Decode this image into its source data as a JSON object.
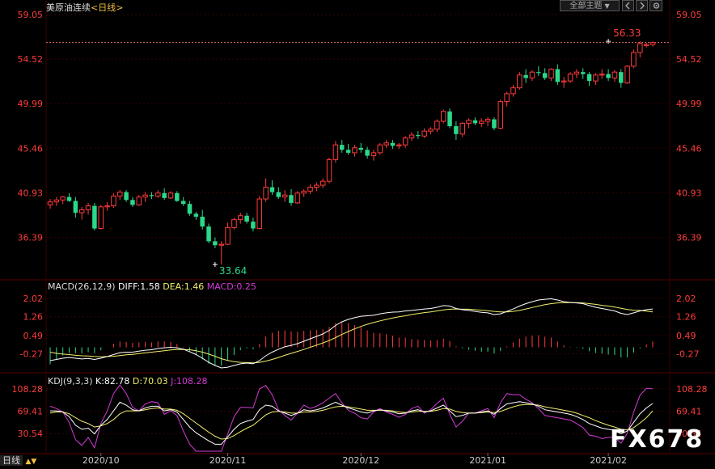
{
  "header": {
    "title": "美原油连续",
    "period_open": "<",
    "period": "日线",
    "period_close": ">"
  },
  "toolbar": {
    "dropdown_label": "全部主题",
    "dropdown_arrow": "▼",
    "prev_icon": "arrow-left-icon",
    "next_icon": "arrow-right-icon",
    "settings_icon": "gear-icon"
  },
  "watermark": "FX678",
  "bottom_bar": {
    "period": "日线",
    "arrows": "▲▼"
  },
  "colors": {
    "background": "#000000",
    "up": "#ff3b3b",
    "down": "#2bd88a",
    "grid": "#3a0000",
    "axis_text": "#ff3b3b",
    "diff": "#ffffff",
    "dea": "#f2ef6a",
    "macd": "#d43bd6",
    "k": "#ffffff",
    "d": "#f2ef6a",
    "j": "#d43bd6",
    "label_low": "#2bd88a",
    "label_high": "#ff3b3b"
  },
  "chart_data": [
    {
      "type": "candlestick",
      "title": "美原油连续 <日线>",
      "x_labels": [
        "2020/10",
        "2020/11",
        "2020/12",
        "2021/01",
        "2021/02"
      ],
      "x_label_index": [
        8,
        28,
        49,
        69,
        88
      ],
      "y_ticks": [
        36.39,
        40.93,
        45.46,
        49.99,
        54.52,
        59.05
      ],
      "ylim": [
        32.25,
        59.05
      ],
      "high_label": "56.33",
      "low_label": "33.64",
      "high_index": 88,
      "low_index": 26,
      "ohlc": [
        [
          39.7,
          40.3,
          39.3,
          40.0
        ],
        [
          40.0,
          40.5,
          39.6,
          40.2
        ],
        [
          40.2,
          40.6,
          39.8,
          40.5
        ],
        [
          40.5,
          40.9,
          40.0,
          40.1
        ],
        [
          40.1,
          40.5,
          38.4,
          38.9
        ],
        [
          38.9,
          39.5,
          38.2,
          39.2
        ],
        [
          39.2,
          39.9,
          38.7,
          39.6
        ],
        [
          39.6,
          39.9,
          37.1,
          37.3
        ],
        [
          37.3,
          39.7,
          37.2,
          39.5
        ],
        [
          39.5,
          40.0,
          39.1,
          39.6
        ],
        [
          39.6,
          40.9,
          39.4,
          40.6
        ],
        [
          40.6,
          41.2,
          40.2,
          41.0
        ],
        [
          41.0,
          41.2,
          40.0,
          40.2
        ],
        [
          40.2,
          40.5,
          39.5,
          39.7
        ],
        [
          39.7,
          40.7,
          39.6,
          40.5
        ],
        [
          40.5,
          41.0,
          40.0,
          40.7
        ],
        [
          40.7,
          41.0,
          40.3,
          40.6
        ],
        [
          40.6,
          41.2,
          40.4,
          40.9
        ],
        [
          40.9,
          41.4,
          40.2,
          40.4
        ],
        [
          40.4,
          41.1,
          40.3,
          40.9
        ],
        [
          40.9,
          41.1,
          40.0,
          40.1
        ],
        [
          40.1,
          40.5,
          39.6,
          39.8
        ],
        [
          39.8,
          40.1,
          38.6,
          38.8
        ],
        [
          38.8,
          39.0,
          38.2,
          38.5
        ],
        [
          38.5,
          39.2,
          37.2,
          37.5
        ],
        [
          37.5,
          37.8,
          35.8,
          36.0
        ],
        [
          36.0,
          36.4,
          35.3,
          35.6
        ],
        [
          35.6,
          36.0,
          33.64,
          35.7
        ],
        [
          35.7,
          37.9,
          35.6,
          37.4
        ],
        [
          37.4,
          38.4,
          37.2,
          38.2
        ],
        [
          38.2,
          38.9,
          37.8,
          38.6
        ],
        [
          38.6,
          38.9,
          37.8,
          38.0
        ],
        [
          38.0,
          38.4,
          37.0,
          37.3
        ],
        [
          37.3,
          40.6,
          37.2,
          40.3
        ],
        [
          40.3,
          42.4,
          40.0,
          41.5
        ],
        [
          41.5,
          42.2,
          40.7,
          41.0
        ],
        [
          41.0,
          41.5,
          40.3,
          40.5
        ],
        [
          40.5,
          41.2,
          40.0,
          40.7
        ],
        [
          40.7,
          41.3,
          39.6,
          39.9
        ],
        [
          39.9,
          41.1,
          39.8,
          40.9
        ],
        [
          40.9,
          41.3,
          40.5,
          41.1
        ],
        [
          41.1,
          41.8,
          40.8,
          41.5
        ],
        [
          41.5,
          42.0,
          41.1,
          41.7
        ],
        [
          41.7,
          42.4,
          41.4,
          42.1
        ],
        [
          42.1,
          44.5,
          41.9,
          44.3
        ],
        [
          44.3,
          46.2,
          44.0,
          45.8
        ],
        [
          45.8,
          46.3,
          45.0,
          45.3
        ],
        [
          45.3,
          45.9,
          44.8,
          45.0
        ],
        [
          45.0,
          45.8,
          44.6,
          45.5
        ],
        [
          45.5,
          46.0,
          45.0,
          45.3
        ],
        [
          45.3,
          45.6,
          44.4,
          44.7
        ],
        [
          44.7,
          45.3,
          44.2,
          45.0
        ],
        [
          45.0,
          46.0,
          44.8,
          45.8
        ],
        [
          45.8,
          46.3,
          45.5,
          46.0
        ],
        [
          46.0,
          46.3,
          45.4,
          45.7
        ],
        [
          45.7,
          46.0,
          45.4,
          45.8
        ],
        [
          45.8,
          46.7,
          45.5,
          46.5
        ],
        [
          46.5,
          47.1,
          46.2,
          46.8
        ],
        [
          46.8,
          47.2,
          46.4,
          46.7
        ],
        [
          46.7,
          47.5,
          46.5,
          47.2
        ],
        [
          47.2,
          47.6,
          46.9,
          47.4
        ],
        [
          47.4,
          48.4,
          47.1,
          48.2
        ],
        [
          48.2,
          49.4,
          48.0,
          49.2
        ],
        [
          49.2,
          49.5,
          47.5,
          47.7
        ],
        [
          47.7,
          48.2,
          46.3,
          46.9
        ],
        [
          46.9,
          48.1,
          46.6,
          48.0
        ],
        [
          48.0,
          48.5,
          47.5,
          48.3
        ],
        [
          48.3,
          48.6,
          47.8,
          48.0
        ],
        [
          48.0,
          48.5,
          47.6,
          48.2
        ],
        [
          48.2,
          48.6,
          47.7,
          48.4
        ],
        [
          48.4,
          48.6,
          47.3,
          47.5
        ],
        [
          47.5,
          50.4,
          47.4,
          50.2
        ],
        [
          50.2,
          51.2,
          49.7,
          51.0
        ],
        [
          51.0,
          51.9,
          50.7,
          51.6
        ],
        [
          51.6,
          53.2,
          51.4,
          52.9
        ],
        [
          52.9,
          53.5,
          52.1,
          52.6
        ],
        [
          52.6,
          53.4,
          52.3,
          53.2
        ],
        [
          53.2,
          53.8,
          52.8,
          53.1
        ],
        [
          53.1,
          53.6,
          52.4,
          52.6
        ],
        [
          52.6,
          53.6,
          52.3,
          53.5
        ],
        [
          53.5,
          54.0,
          51.9,
          52.2
        ],
        [
          52.2,
          52.7,
          51.6,
          52.3
        ],
        [
          52.3,
          53.2,
          52.1,
          53.0
        ],
        [
          53.0,
          53.5,
          52.6,
          53.2
        ],
        [
          53.2,
          53.6,
          52.5,
          53.0
        ],
        [
          53.0,
          53.2,
          51.8,
          52.3
        ],
        [
          52.3,
          53.1,
          51.9,
          52.9
        ],
        [
          52.9,
          53.5,
          52.5,
          53.0
        ],
        [
          53.0,
          53.5,
          52.3,
          52.6
        ],
        [
          52.6,
          53.4,
          52.2,
          53.2
        ],
        [
          53.2,
          53.5,
          51.6,
          52.1
        ],
        [
          52.1,
          53.9,
          52.0,
          53.8
        ],
        [
          53.8,
          55.5,
          53.6,
          55.2
        ],
        [
          55.2,
          56.33,
          54.7,
          56.1
        ],
        [
          55.9,
          56.2,
          55.7,
          56.0
        ],
        [
          56.0,
          56.3,
          55.8,
          56.2
        ]
      ]
    },
    {
      "type": "line",
      "title": "MACD(26,12,9)",
      "readout": [
        {
          "name": "DIFF",
          "text": "DIFF:1.58"
        },
        {
          "name": "DEA",
          "text": "DEA:1.46"
        },
        {
          "name": "MACD",
          "text": "MACD:0.25"
        }
      ],
      "header_label": "MACD(26,12,9)",
      "y_ticks": [
        -0.27,
        0.49,
        1.26,
        2.02
      ],
      "ylim": [
        -0.95,
        2.25
      ],
      "diff": [
        -0.55,
        -0.5,
        -0.45,
        -0.42,
        -0.45,
        -0.48,
        -0.46,
        -0.5,
        -0.45,
        -0.38,
        -0.3,
        -0.22,
        -0.2,
        -0.2,
        -0.16,
        -0.12,
        -0.1,
        -0.05,
        -0.02,
        0.0,
        -0.02,
        -0.08,
        -0.18,
        -0.3,
        -0.45,
        -0.62,
        -0.75,
        -0.85,
        -0.82,
        -0.75,
        -0.68,
        -0.65,
        -0.68,
        -0.55,
        -0.35,
        -0.2,
        -0.08,
        0.02,
        0.08,
        0.15,
        0.25,
        0.35,
        0.45,
        0.55,
        0.7,
        0.9,
        1.05,
        1.15,
        1.22,
        1.28,
        1.3,
        1.32,
        1.38,
        1.42,
        1.45,
        1.46,
        1.5,
        1.52,
        1.55,
        1.58,
        1.6,
        1.65,
        1.72,
        1.7,
        1.6,
        1.55,
        1.52,
        1.48,
        1.44,
        1.42,
        1.35,
        1.38,
        1.48,
        1.58,
        1.7,
        1.8,
        1.88,
        1.95,
        1.98,
        2.0,
        1.95,
        1.88,
        1.85,
        1.83,
        1.8,
        1.72,
        1.65,
        1.6,
        1.55,
        1.5,
        1.4,
        1.35,
        1.42,
        1.5,
        1.55,
        1.58
      ],
      "dea": [
        -0.2,
        -0.25,
        -0.28,
        -0.3,
        -0.33,
        -0.35,
        -0.36,
        -0.38,
        -0.39,
        -0.38,
        -0.37,
        -0.34,
        -0.31,
        -0.29,
        -0.26,
        -0.23,
        -0.2,
        -0.17,
        -0.14,
        -0.11,
        -0.09,
        -0.09,
        -0.1,
        -0.14,
        -0.2,
        -0.28,
        -0.37,
        -0.47,
        -0.54,
        -0.59,
        -0.62,
        -0.63,
        -0.64,
        -0.62,
        -0.57,
        -0.5,
        -0.42,
        -0.33,
        -0.25,
        -0.17,
        -0.09,
        0.0,
        0.09,
        0.18,
        0.28,
        0.4,
        0.53,
        0.65,
        0.76,
        0.86,
        0.95,
        1.02,
        1.09,
        1.15,
        1.21,
        1.26,
        1.3,
        1.35,
        1.39,
        1.43,
        1.46,
        1.5,
        1.54,
        1.57,
        1.58,
        1.57,
        1.57,
        1.55,
        1.53,
        1.51,
        1.48,
        1.46,
        1.46,
        1.48,
        1.52,
        1.58,
        1.64,
        1.7,
        1.76,
        1.8,
        1.83,
        1.84,
        1.84,
        1.84,
        1.83,
        1.8,
        1.77,
        1.73,
        1.7,
        1.66,
        1.61,
        1.56,
        1.53,
        1.52,
        1.49,
        1.46
      ],
      "macd_hist": [
        -0.7,
        -0.5,
        -0.34,
        -0.24,
        -0.24,
        -0.26,
        -0.2,
        -0.24,
        -0.12,
        0.0,
        0.14,
        0.24,
        0.22,
        0.18,
        0.2,
        0.22,
        0.2,
        0.24,
        0.24,
        0.22,
        0.14,
        0.02,
        -0.16,
        -0.32,
        -0.5,
        -0.68,
        -0.76,
        -0.76,
        -0.56,
        -0.32,
        -0.12,
        -0.04,
        -0.08,
        0.14,
        0.44,
        0.6,
        0.68,
        0.7,
        0.66,
        0.64,
        0.68,
        0.7,
        0.72,
        0.74,
        0.84,
        1.0,
        1.04,
        1.0,
        0.92,
        0.84,
        0.7,
        0.6,
        0.58,
        0.54,
        0.48,
        0.4,
        0.4,
        0.34,
        0.32,
        0.3,
        0.28,
        0.3,
        0.36,
        0.26,
        0.04,
        -0.04,
        -0.1,
        -0.14,
        -0.18,
        -0.18,
        -0.26,
        -0.16,
        0.04,
        0.2,
        0.36,
        0.44,
        0.48,
        0.5,
        0.44,
        0.4,
        0.24,
        0.08,
        0.02,
        -0.02,
        -0.06,
        -0.16,
        -0.24,
        -0.26,
        -0.3,
        -0.32,
        -0.42,
        -0.42,
        -0.22,
        -0.04,
        0.12,
        0.24
      ]
    },
    {
      "type": "line",
      "title": "KDJ(9,3,3)",
      "readout": [
        {
          "name": "K",
          "text": "K:82.78"
        },
        {
          "name": "D",
          "text": "D:70.03"
        },
        {
          "name": "J",
          "text": "J:108.28"
        }
      ],
      "header_label": "KDJ(9,3,3)",
      "y_ticks": [
        30.54,
        69.41,
        108.28
      ],
      "ylim": [
        0,
        115
      ],
      "k": [
        70,
        70,
        68,
        60,
        45,
        38,
        40,
        30,
        45,
        55,
        70,
        85,
        80,
        72,
        70,
        75,
        78,
        78,
        70,
        72,
        68,
        55,
        42,
        32,
        25,
        18,
        12,
        12,
        25,
        38,
        48,
        52,
        55,
        72,
        80,
        78,
        70,
        66,
        62,
        66,
        72,
        70,
        72,
        75,
        80,
        85,
        80,
        75,
        72,
        68,
        66,
        70,
        72,
        70,
        68,
        65,
        66,
        70,
        72,
        68,
        70,
        75,
        80,
        70,
        60,
        62,
        66,
        66,
        68,
        70,
        64,
        74,
        82,
        84,
        86,
        84,
        82,
        78,
        72,
        70,
        68,
        66,
        64,
        60,
        55,
        48,
        44,
        40,
        38,
        36,
        30,
        35,
        50,
        65,
        75,
        82.78
      ],
      "d": [
        66,
        68,
        68,
        65,
        58,
        52,
        48,
        42,
        44,
        48,
        55,
        65,
        70,
        70,
        70,
        72,
        74,
        75,
        73,
        73,
        71,
        65,
        57,
        49,
        41,
        33,
        26,
        21,
        22,
        27,
        34,
        40,
        45,
        54,
        63,
        68,
        69,
        68,
        66,
        66,
        68,
        68,
        69,
        71,
        74,
        77,
        78,
        77,
        75,
        73,
        71,
        71,
        71,
        71,
        70,
        68,
        67,
        68,
        69,
        69,
        69,
        71,
        74,
        73,
        69,
        67,
        66,
        66,
        67,
        68,
        67,
        69,
        73,
        77,
        80,
        81,
        81,
        80,
        77,
        75,
        73,
        71,
        69,
        66,
        62,
        58,
        53,
        49,
        45,
        42,
        38,
        37,
        41,
        49,
        58,
        70.03
      ],
      "j": [
        78,
        74,
        68,
        50,
        20,
        10,
        24,
        6,
        48,
        70,
        100,
        125,
        100,
        76,
        70,
        82,
        86,
        84,
        64,
        70,
        62,
        35,
        12,
        0,
        0,
        0,
        0,
        0,
        30,
        60,
        76,
        76,
        75,
        108,
        114,
        98,
        72,
        62,
        54,
        66,
        80,
        74,
        78,
        84,
        92,
        100,
        84,
        71,
        66,
        58,
        56,
        68,
        74,
        68,
        64,
        59,
        64,
        74,
        78,
        66,
        72,
        83,
        92,
        64,
        42,
        52,
        66,
        66,
        70,
        74,
        58,
        84,
        100,
        98,
        98,
        90,
        84,
        74,
        62,
        60,
        58,
        56,
        54,
        48,
        41,
        28,
        26,
        22,
        24,
        24,
        14,
        31,
        68,
        97,
        109,
        108.28
      ]
    }
  ]
}
